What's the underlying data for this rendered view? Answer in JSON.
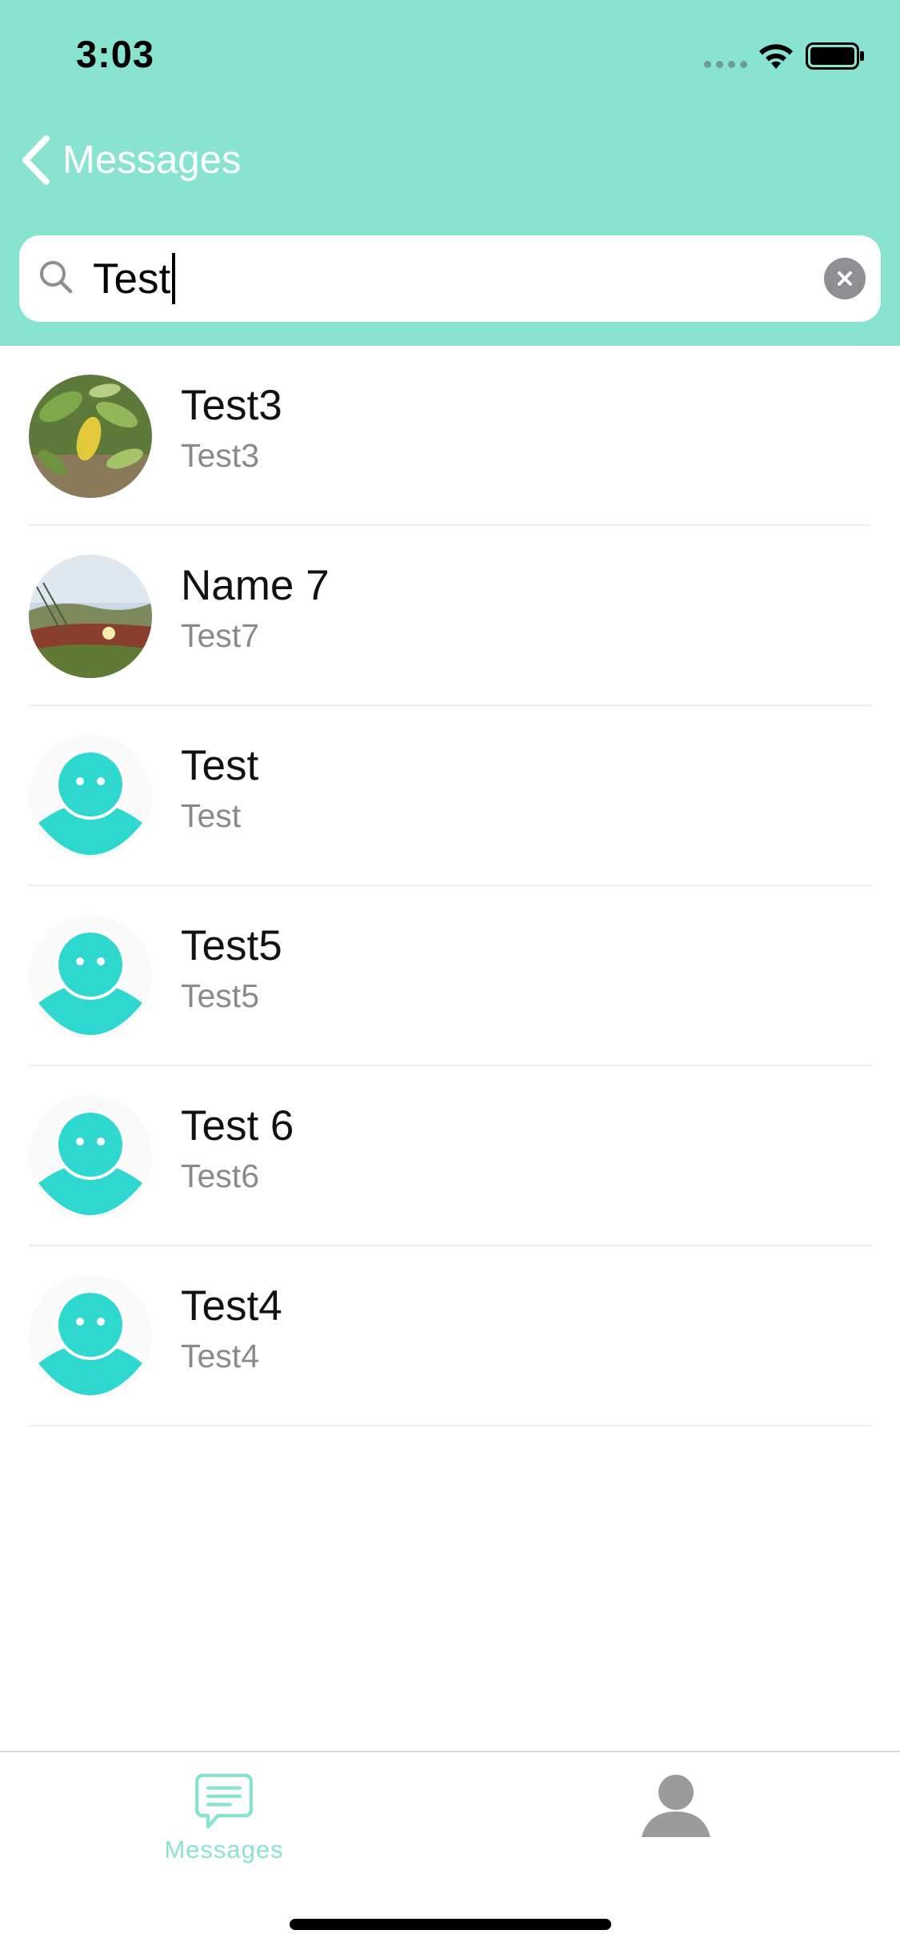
{
  "status_bar": {
    "time": "3:03"
  },
  "nav": {
    "back_label": "Messages"
  },
  "search": {
    "value": "Test"
  },
  "contacts": [
    {
      "name": "Test3",
      "subtitle": "Test3",
      "avatar": "photo-leaves"
    },
    {
      "name": "Name 7",
      "subtitle": "Test7",
      "avatar": "photo-plants"
    },
    {
      "name": "Test",
      "subtitle": "Test",
      "avatar": "default-person-icon"
    },
    {
      "name": "Test5",
      "subtitle": "Test5",
      "avatar": "default-person-icon"
    },
    {
      "name": "Test 6",
      "subtitle": "Test6",
      "avatar": "default-person-icon"
    },
    {
      "name": "Test4",
      "subtitle": "Test4",
      "avatar": "default-person-icon"
    }
  ],
  "tabbar": {
    "messages_label": "Messages",
    "messages_icon": "chat-bubble-icon",
    "profile_icon": "person-icon"
  },
  "colors": {
    "header": "#89e3d1",
    "accent": "#2ed8cf",
    "tab_active": "#89e3d1",
    "tab_inactive": "#9b9b9b"
  }
}
